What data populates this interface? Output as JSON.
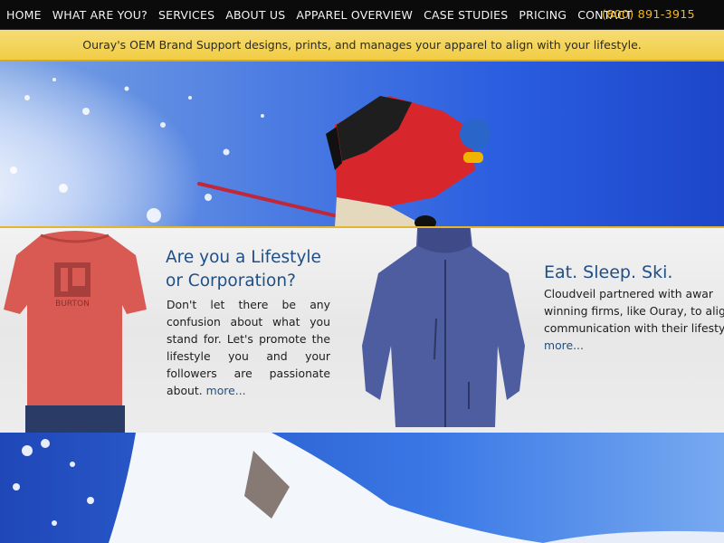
{
  "nav": {
    "items": [
      {
        "label": "HOME"
      },
      {
        "label": "WHAT ARE YOU?"
      },
      {
        "label": "SERVICES"
      },
      {
        "label": "ABOUT US"
      },
      {
        "label": "APPAREL OVERVIEW"
      },
      {
        "label": "CASE STUDIES"
      },
      {
        "label": "PRICING"
      },
      {
        "label": "CONTACT"
      }
    ],
    "phone": "(800) 891-3915"
  },
  "tagline": "Ouray's OEM Brand Support designs, prints, and manages your apparel to align with your lifestyle.",
  "promos": [
    {
      "title": "Are you a Lifestyle or Corporation?",
      "text": "Don't let there be any confusion about what you stand for. Let's promote the lifestyle you and your followers are passionate about.",
      "more": "more..."
    },
    {
      "title": "Eat. Sleep. Ski.",
      "text_lines": [
        "Cloudveil partnered with awar",
        "winning firms, like Ouray, to align",
        "communication with their lifesty"
      ],
      "more": "more..."
    }
  ],
  "shirt_logo_text": "BURTON",
  "colors": {
    "nav_bg": "#0b0b0b",
    "phone": "#f2b718",
    "tagline_bg": "#f3d457",
    "accent_border": "#e5b52c",
    "heading_blue": "#1f4f86",
    "sky_blue": "#1b4fd6"
  }
}
